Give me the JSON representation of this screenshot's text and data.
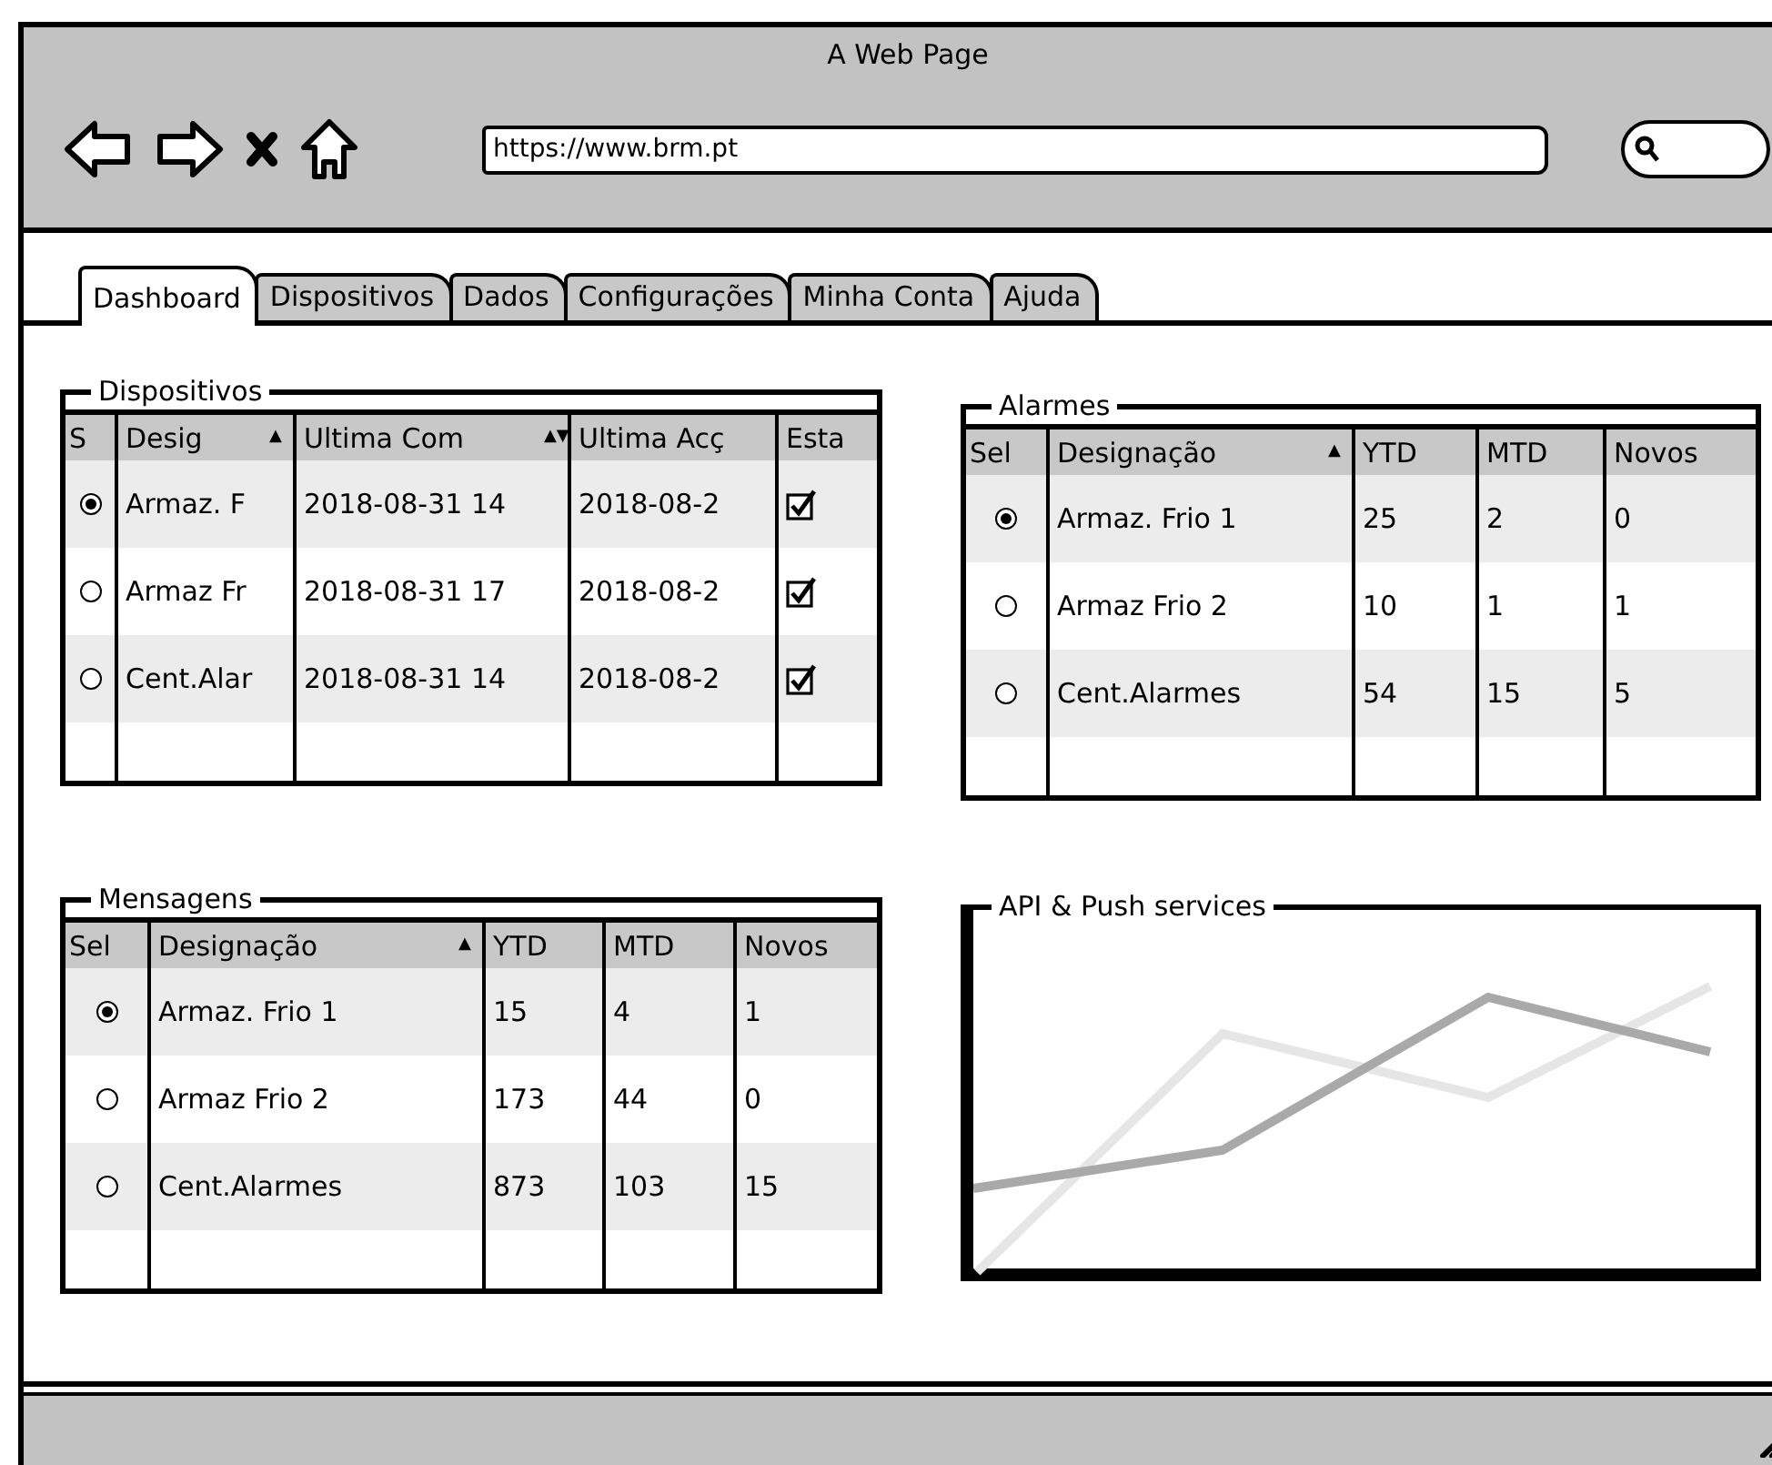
{
  "window": {
    "title": "A Web Page",
    "url": "https://www.brm.pt"
  },
  "tabs": [
    {
      "label": "Dashboard",
      "selected": true
    },
    {
      "label": "Dispositivos",
      "selected": false
    },
    {
      "label": "Dados",
      "selected": false
    },
    {
      "label": "Configurações",
      "selected": false
    },
    {
      "label": "Minha Conta",
      "selected": false
    },
    {
      "label": "Ajuda",
      "selected": false
    }
  ],
  "dispositivos": {
    "title": "Dispositivos",
    "columns": [
      {
        "label": "S"
      },
      {
        "label": "Desig",
        "sort_mark": "▲"
      },
      {
        "label": "Ultima Com",
        "sort_mark": "▲▼"
      },
      {
        "label": "Ultima Acç"
      },
      {
        "label": "Esta"
      }
    ],
    "rows": [
      {
        "cells": [
          {
            "kind": "radio",
            "selected": true
          },
          {
            "kind": "text",
            "text": "Armaz. F"
          },
          {
            "kind": "text",
            "text": "2018-08-31 14"
          },
          {
            "kind": "text",
            "text": "2018-08-2"
          },
          {
            "kind": "checkbox",
            "checked": true
          }
        ]
      },
      {
        "cells": [
          {
            "kind": "radio",
            "selected": false
          },
          {
            "kind": "text",
            "text": "Armaz Fr"
          },
          {
            "kind": "text",
            "text": "2018-08-31 17"
          },
          {
            "kind": "text",
            "text": "2018-08-2"
          },
          {
            "kind": "checkbox",
            "checked": true
          }
        ]
      },
      {
        "cells": [
          {
            "kind": "radio",
            "selected": false
          },
          {
            "kind": "text",
            "text": "Cent.Alar"
          },
          {
            "kind": "text",
            "text": "2018-08-31 14"
          },
          {
            "kind": "text",
            "text": "2018-08-2"
          },
          {
            "kind": "checkbox",
            "checked": true
          }
        ]
      }
    ]
  },
  "alarmes": {
    "title": "Alarmes",
    "columns": [
      {
        "label": "Sel"
      },
      {
        "label": "Designação",
        "sort_mark": "▲"
      },
      {
        "label": "YTD"
      },
      {
        "label": "MTD"
      },
      {
        "label": "Novos"
      }
    ],
    "rows": [
      {
        "cells": [
          {
            "kind": "radio",
            "selected": true
          },
          {
            "kind": "text",
            "text": "Armaz. Frio 1"
          },
          {
            "kind": "text",
            "text": "25"
          },
          {
            "kind": "text",
            "text": "2"
          },
          {
            "kind": "text",
            "text": "0"
          }
        ]
      },
      {
        "cells": [
          {
            "kind": "radio",
            "selected": false
          },
          {
            "kind": "text",
            "text": "Armaz Frio 2"
          },
          {
            "kind": "text",
            "text": "10"
          },
          {
            "kind": "text",
            "text": "1"
          },
          {
            "kind": "text",
            "text": "1"
          }
        ]
      },
      {
        "cells": [
          {
            "kind": "radio",
            "selected": false
          },
          {
            "kind": "text",
            "text": "Cent.Alarmes"
          },
          {
            "kind": "text",
            "text": "54"
          },
          {
            "kind": "text",
            "text": "15"
          },
          {
            "kind": "text",
            "text": "5"
          }
        ]
      }
    ]
  },
  "mensagens": {
    "title": "Mensagens",
    "columns": [
      {
        "label": "Sel"
      },
      {
        "label": "Designação",
        "sort_mark": "▲"
      },
      {
        "label": "YTD"
      },
      {
        "label": "MTD"
      },
      {
        "label": "Novos"
      }
    ],
    "rows": [
      {
        "cells": [
          {
            "kind": "radio",
            "selected": true
          },
          {
            "kind": "text",
            "text": "Armaz. Frio 1"
          },
          {
            "kind": "text",
            "text": "15"
          },
          {
            "kind": "text",
            "text": "4"
          },
          {
            "kind": "text",
            "text": "1"
          }
        ]
      },
      {
        "cells": [
          {
            "kind": "radio",
            "selected": false
          },
          {
            "kind": "text",
            "text": "Armaz Frio 2"
          },
          {
            "kind": "text",
            "text": "173"
          },
          {
            "kind": "text",
            "text": "44"
          },
          {
            "kind": "text",
            "text": "0"
          }
        ]
      },
      {
        "cells": [
          {
            "kind": "radio",
            "selected": false
          },
          {
            "kind": "text",
            "text": "Cent.Alarmes"
          },
          {
            "kind": "text",
            "text": "873"
          },
          {
            "kind": "text",
            "text": "103"
          },
          {
            "kind": "text",
            "text": "15"
          }
        ]
      }
    ]
  },
  "chart_panel": {
    "title": "API & Push services"
  }
}
